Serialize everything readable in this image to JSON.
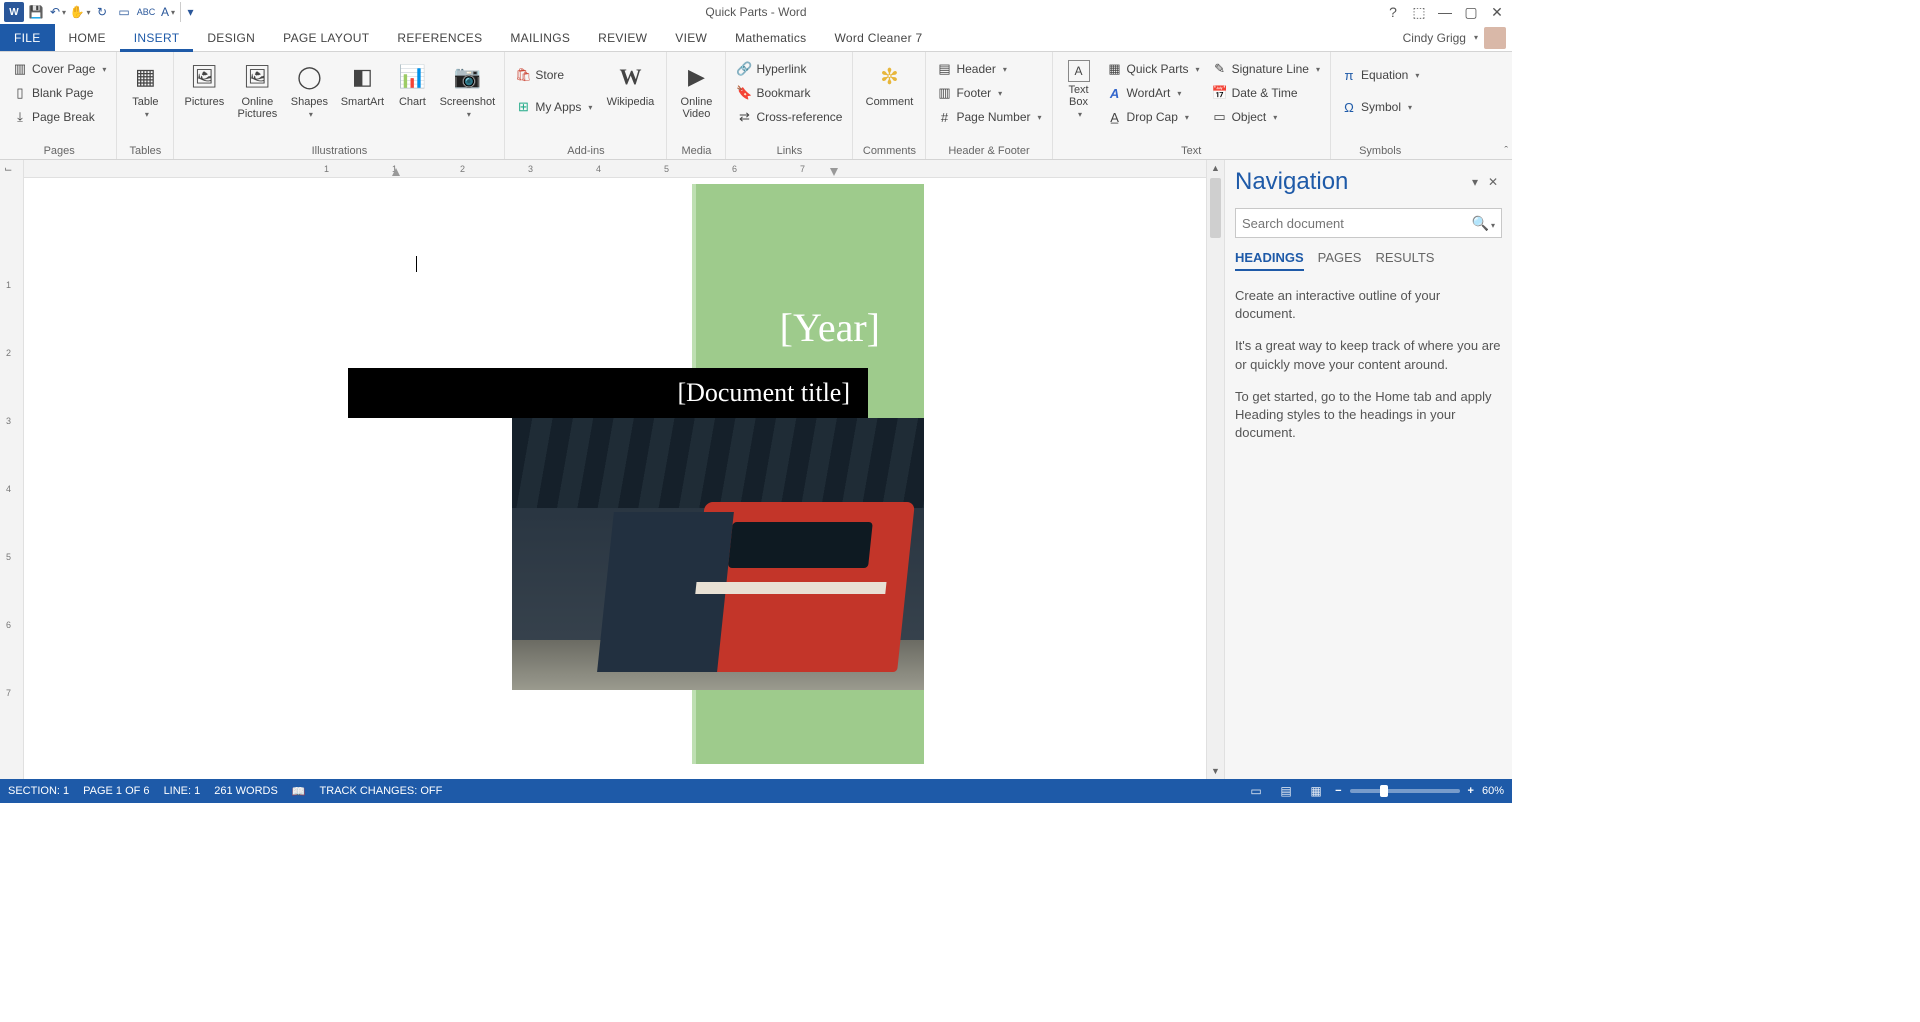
{
  "titlebar": {
    "title": "Quick Parts - Word",
    "user": "Cindy Grigg"
  },
  "tabs": {
    "file": "FILE",
    "home": "HOME",
    "insert": "INSERT",
    "design": "DESIGN",
    "page_layout": "PAGE LAYOUT",
    "references": "REFERENCES",
    "mailings": "MAILINGS",
    "review": "REVIEW",
    "view": "VIEW",
    "mathematics": "Mathematics",
    "word_cleaner": "Word Cleaner 7"
  },
  "ribbon": {
    "pages": {
      "group": "Pages",
      "cover_page": "Cover Page",
      "blank_page": "Blank Page",
      "page_break": "Page Break"
    },
    "tables": {
      "group": "Tables",
      "table": "Table"
    },
    "illustrations": {
      "group": "Illustrations",
      "pictures": "Pictures",
      "online_pictures": "Online\nPictures",
      "shapes": "Shapes",
      "smartart": "SmartArt",
      "chart": "Chart",
      "screenshot": "Screenshot"
    },
    "addins": {
      "group": "Add-ins",
      "store": "Store",
      "my_apps": "My Apps",
      "wikipedia": "Wikipedia"
    },
    "media": {
      "group": "Media",
      "online_video": "Online\nVideo"
    },
    "links": {
      "group": "Links",
      "hyperlink": "Hyperlink",
      "bookmark": "Bookmark",
      "cross_reference": "Cross-reference"
    },
    "comments": {
      "group": "Comments",
      "comment": "Comment"
    },
    "header_footer": {
      "group": "Header & Footer",
      "header": "Header",
      "footer": "Footer",
      "page_number": "Page Number"
    },
    "text": {
      "group": "Text",
      "text_box": "Text\nBox",
      "quick_parts": "Quick Parts",
      "wordart": "WordArt",
      "drop_cap": "Drop Cap",
      "signature_line": "Signature Line",
      "date_time": "Date & Time",
      "object": "Object"
    },
    "symbols": {
      "group": "Symbols",
      "equation": "Equation",
      "symbol": "Symbol"
    }
  },
  "ruler": {
    "marks": [
      "1",
      "1",
      "2",
      "3",
      "4",
      "5",
      "6",
      "7"
    ]
  },
  "ruler_v": {
    "marks": [
      "1",
      "2",
      "3",
      "4",
      "5",
      "6",
      "7"
    ]
  },
  "document": {
    "year": "[Year]",
    "title": "[Document title]"
  },
  "nav": {
    "title": "Navigation",
    "search_placeholder": "Search document",
    "tabs": {
      "headings": "HEADINGS",
      "pages": "PAGES",
      "results": "RESULTS"
    },
    "body1": "Create an interactive outline of your document.",
    "body2": "It's a great way to keep track of where you are or quickly move your content around.",
    "body3": "To get started, go to the Home tab and apply Heading styles to the headings in your document."
  },
  "status": {
    "section": "SECTION: 1",
    "page": "PAGE 1 OF 6",
    "line": "LINE: 1",
    "words": "261 WORDS",
    "track": "TRACK CHANGES: OFF",
    "zoom": "60%"
  }
}
